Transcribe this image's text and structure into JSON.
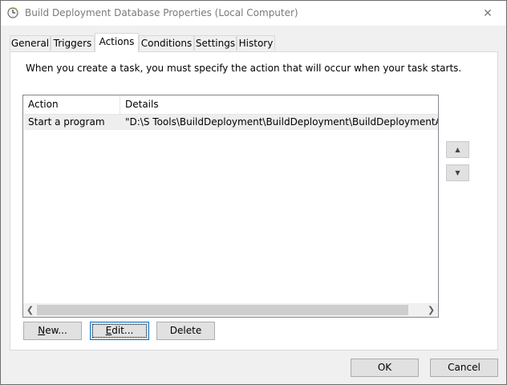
{
  "window": {
    "title": "Build Deployment Database Properties (Local Computer)",
    "close_glyph": "✕",
    "icon": "clock-icon"
  },
  "tabs": [
    {
      "label": "General",
      "active": false
    },
    {
      "label": "Triggers",
      "active": false
    },
    {
      "label": "Actions",
      "active": true
    },
    {
      "label": "Conditions",
      "active": false
    },
    {
      "label": "Settings",
      "active": false
    },
    {
      "label": "History",
      "active": false
    }
  ],
  "actions_panel": {
    "intro_text": "When you create a task, you must specify the action that will occur when your task starts.",
    "columns": [
      "Action",
      "Details"
    ],
    "rows": [
      {
        "action": "Start a program",
        "details": "\"D:\\S Tools\\BuildDeployment\\BuildDeployment\\BuildDeploymentAppUtil"
      }
    ],
    "buttons": {
      "new": {
        "label": "New...",
        "mnemonic": "N",
        "rest": "ew..."
      },
      "edit": {
        "label": "Edit...",
        "mnemonic": "E",
        "rest": "dit..."
      },
      "delete": {
        "label": "Delete",
        "mnemonic": "",
        "rest": "Delete"
      }
    },
    "move_up_icon": "arrow-up-icon",
    "move_down_icon": "arrow-down-icon"
  },
  "dialog_buttons": {
    "ok": "OK",
    "cancel": "Cancel"
  },
  "colors": {
    "focus_border": "#0078d7",
    "selected_row": "#eeeeee"
  }
}
